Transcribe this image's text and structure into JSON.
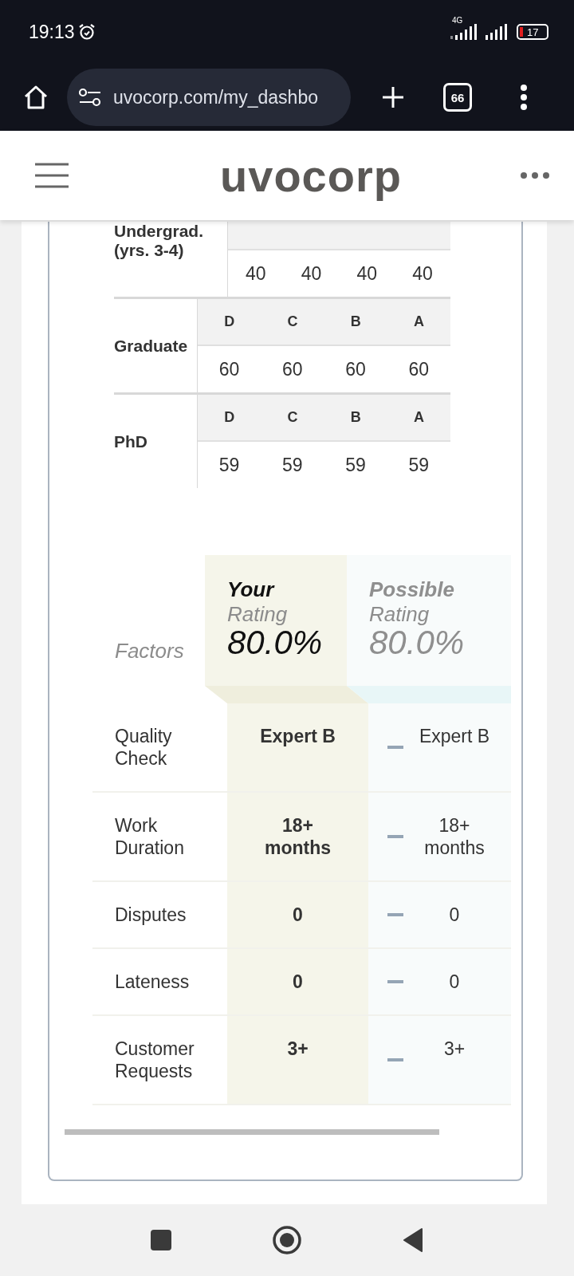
{
  "status_bar": {
    "time": "19:13",
    "network": "4G",
    "battery": "17"
  },
  "browser": {
    "url": "uvocorp.com/my_dashbo",
    "tab_count": "66"
  },
  "site_header": {
    "logo": "uvocorp"
  },
  "grade_table": {
    "rows": [
      {
        "label": [
          "Undergrad.",
          "(yrs. 3-4)"
        ],
        "values": [
          "40",
          "40",
          "40",
          "40"
        ]
      },
      {
        "label": [
          "Graduate"
        ],
        "grades": [
          "D",
          "C",
          "B",
          "A"
        ],
        "values": [
          "60",
          "60",
          "60",
          "60"
        ]
      },
      {
        "label": [
          "PhD"
        ],
        "grades": [
          "D",
          "C",
          "B",
          "A"
        ],
        "values": [
          "59",
          "59",
          "59",
          "59"
        ]
      }
    ]
  },
  "rating": {
    "factors_label": "Factors",
    "columns": [
      {
        "kind": "yours",
        "title": "Your",
        "subtitle": "Rating",
        "value": "80.0%"
      },
      {
        "kind": "possible",
        "title": "Possible",
        "subtitle": "Rating",
        "value": "80.0%"
      }
    ],
    "rows": [
      {
        "factor": "Quality Check",
        "yours": "Expert B",
        "possible": "Expert B"
      },
      {
        "factor": "Work Duration",
        "yours": "18+ months",
        "possible": "18+ months"
      },
      {
        "factor": "Disputes",
        "yours": "0",
        "possible": "0"
      },
      {
        "factor": "Lateness",
        "yours": "0",
        "possible": "0"
      },
      {
        "factor": "Customer Requests",
        "yours": "3+",
        "possible": "3+"
      }
    ]
  }
}
